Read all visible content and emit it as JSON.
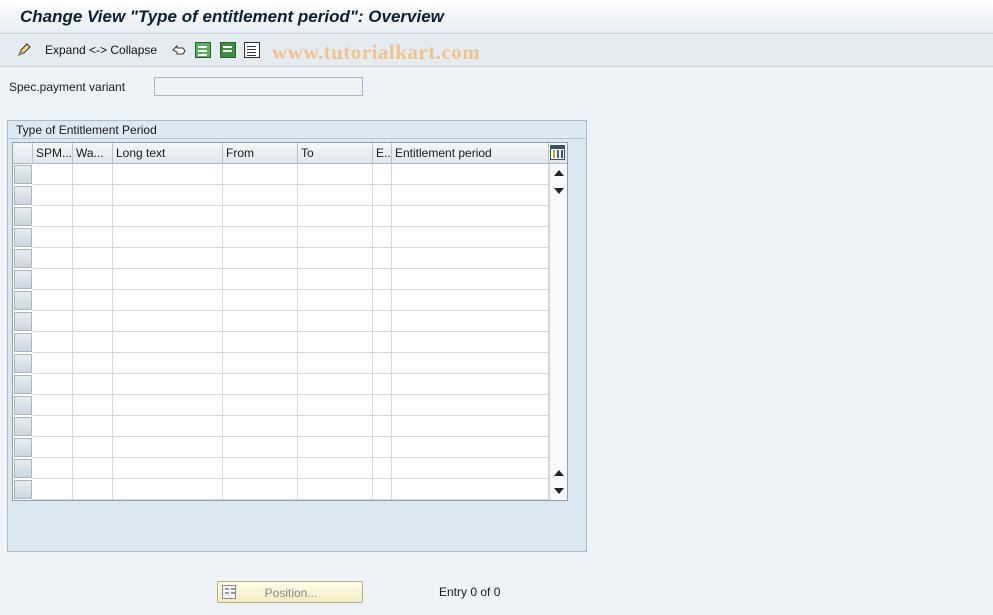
{
  "title": "Change View \"Type of entitlement period\": Overview",
  "toolbar": {
    "expand_collapse": "Expand <-> Collapse",
    "icons": [
      "edit-pencil-icon",
      "undo-icon",
      "select-all-icon",
      "select-block-icon",
      "deselect-all-icon"
    ]
  },
  "watermark": "www.tutorialkart.com",
  "field": {
    "label": "Spec.payment variant",
    "value": ""
  },
  "group": {
    "title": "Type of Entitlement Period",
    "columns": [
      "SPM...",
      "Wa...",
      "Long text",
      "From",
      "To",
      "E..",
      "Entitlement period"
    ],
    "visible_rows": 16
  },
  "footer": {
    "position_button": "Position...",
    "entry": "Entry 0 of 0"
  }
}
